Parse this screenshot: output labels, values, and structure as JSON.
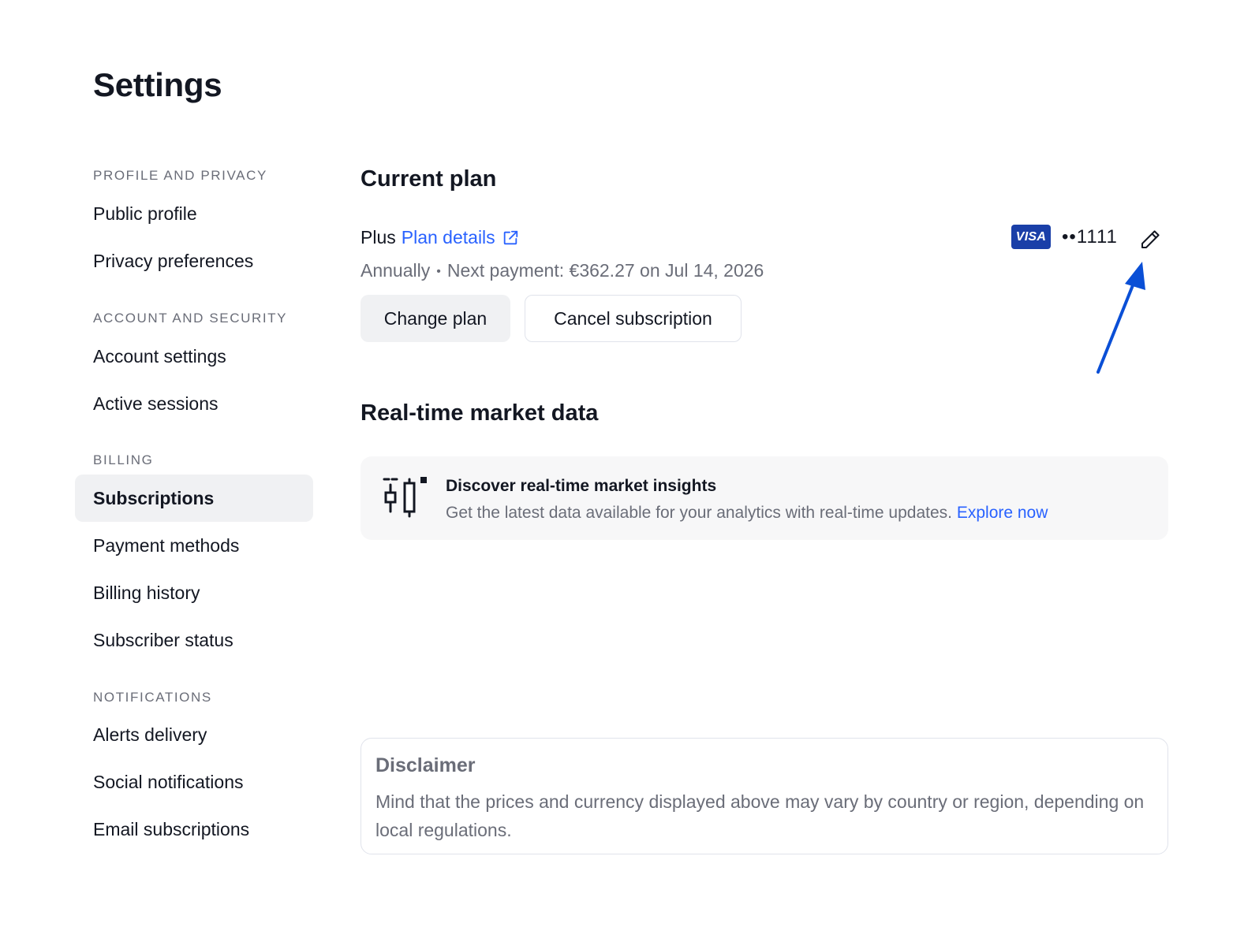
{
  "page": {
    "title": "Settings"
  },
  "sidebar": {
    "sections": [
      {
        "header": "PROFILE AND PRIVACY",
        "items": [
          "Public profile",
          "Privacy preferences"
        ]
      },
      {
        "header": "ACCOUNT AND SECURITY",
        "items": [
          "Account settings",
          "Active sessions"
        ]
      },
      {
        "header": "BILLING",
        "items": [
          "Subscriptions",
          "Payment methods",
          "Billing history",
          "Subscriber status"
        ]
      },
      {
        "header": "NOTIFICATIONS",
        "items": [
          "Alerts delivery",
          "Social notifications",
          "Email subscriptions"
        ]
      }
    ],
    "active_item": "Subscriptions"
  },
  "current_plan": {
    "heading": "Current plan",
    "plan_name": "Plus",
    "plan_details_link": "Plan details",
    "billing_period": "Annually",
    "separator": "•",
    "next_payment": "Next payment: €362.27 on Jul 14, 2026",
    "change_plan_button": "Change plan",
    "cancel_button": "Cancel subscription",
    "card_brand": "VISA",
    "card_number": "••1111"
  },
  "market_data": {
    "heading": "Real-time market data",
    "promo_title": "Discover real-time market insights",
    "promo_text": "Get the latest data available for your analytics with real-time updates.",
    "promo_link": "Explore now"
  },
  "disclaimer": {
    "title": "Disclaimer",
    "text": "Mind that the prices and currency displayed above may vary by country or region, depending on local regulations."
  },
  "colors": {
    "link": "#2962ff",
    "annotation_arrow": "#0a4fd6",
    "visa_bg": "#1a3fa8"
  }
}
